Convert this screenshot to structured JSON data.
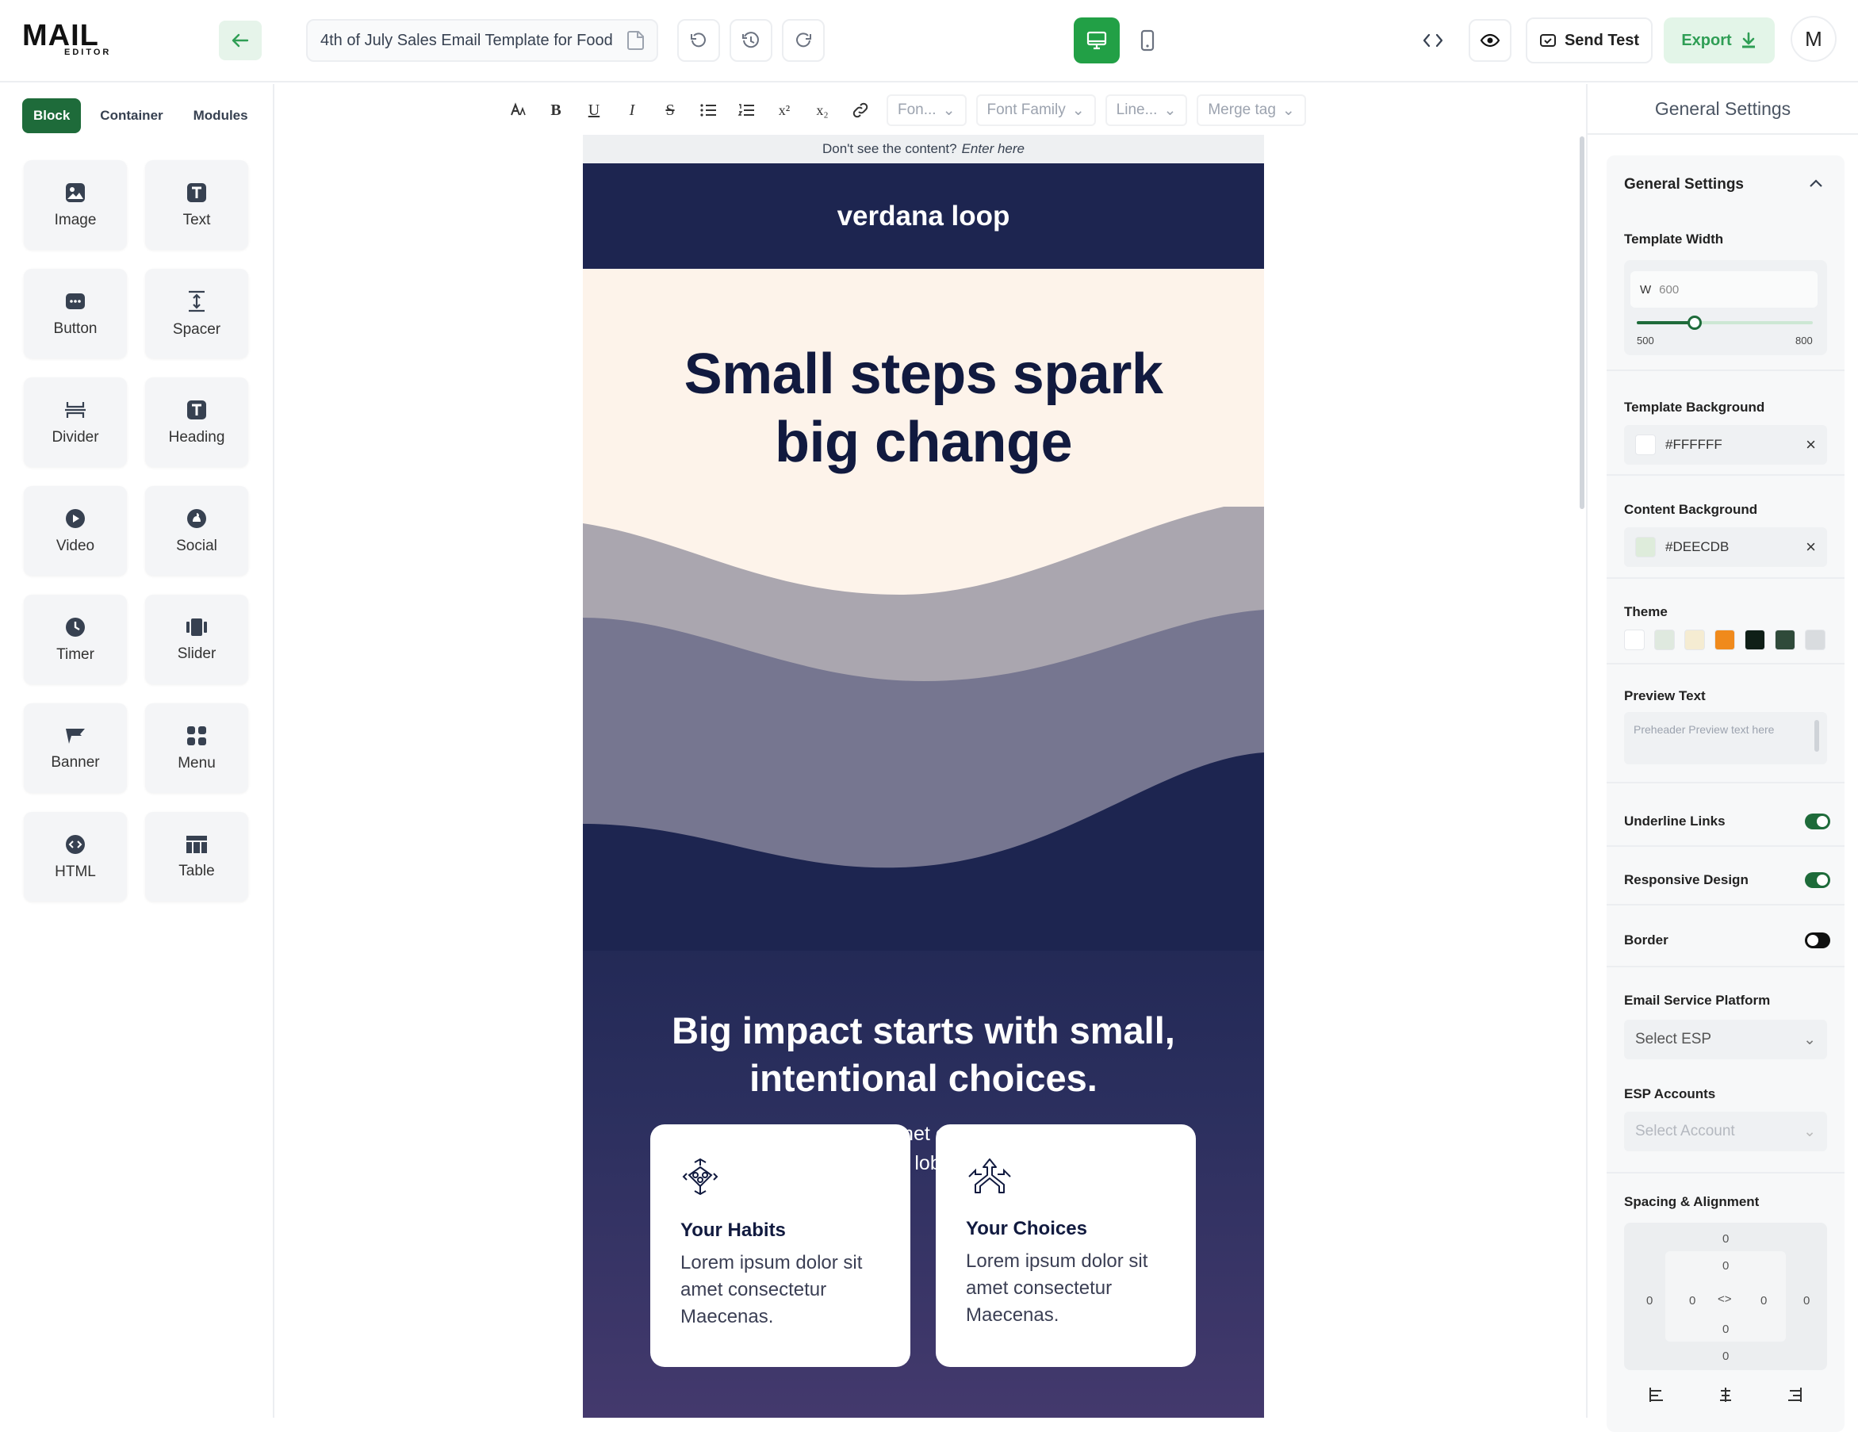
{
  "app": {
    "logo_main": "MAIL",
    "logo_sub": "EDITOR",
    "avatar": "M"
  },
  "topbar": {
    "doc_title": "4th of July Sales Email Template for Food",
    "send_test": "Send Test",
    "export": "Export"
  },
  "left": {
    "tabs": [
      "Block",
      "Container",
      "Modules"
    ],
    "blocks": [
      {
        "label": "Image",
        "icon": "image-icon"
      },
      {
        "label": "Text",
        "icon": "text-icon"
      },
      {
        "label": "Button",
        "icon": "button-icon"
      },
      {
        "label": "Spacer",
        "icon": "spacer-icon"
      },
      {
        "label": "Divider",
        "icon": "divider-icon"
      },
      {
        "label": "Heading",
        "icon": "heading-icon"
      },
      {
        "label": "Video",
        "icon": "video-icon"
      },
      {
        "label": "Social",
        "icon": "social-icon"
      },
      {
        "label": "Timer",
        "icon": "timer-icon"
      },
      {
        "label": "Slider",
        "icon": "slider-icon"
      },
      {
        "label": "Banner",
        "icon": "banner-icon"
      },
      {
        "label": "Menu",
        "icon": "menu-icon"
      },
      {
        "label": "HTML",
        "icon": "html-icon"
      },
      {
        "label": "Table",
        "icon": "table-icon"
      }
    ]
  },
  "toolbar": {
    "font_size": "Fon...",
    "font_family": "Font Family",
    "line_height": "Line...",
    "merge_tag": "Merge tag"
  },
  "email": {
    "notice": "Don't see the content?",
    "notice_link": "Enter here",
    "brand": "verdana loop",
    "hero_line1": "Small steps spark",
    "hero_line2": "big change",
    "sub_line1": "Big impact starts with small,",
    "sub_line2": "intentional choices.",
    "lead_line1": "Lorem ipsum dolor sit amet consectetur. Risus ipsum",
    "lead_line2": "mattis tristique lobortis convallis.",
    "cards": [
      {
        "title": "Your Habits",
        "line1": "Lorem ipsum dolor sit",
        "line2": "amet consectetur",
        "line3": "Maecenas."
      },
      {
        "title": "Your Choices",
        "line1": "Lorem ipsum dolor sit",
        "line2": "amet consectetur",
        "line3": "Maecenas."
      }
    ]
  },
  "settings": {
    "header": "General Settings",
    "section_title": "General Settings",
    "template_width": "Template Width",
    "width_prefix": "W",
    "width_value": "600",
    "width_min": "500",
    "width_max": "800",
    "width_fraction": 0.33,
    "template_bg_label": "Template Background",
    "template_bg": "#FFFFFF",
    "content_bg_label": "Content Background",
    "content_bg": "#DEECDB",
    "theme_label": "Theme",
    "theme_colors": [
      "#ffffff",
      "#dfe9df",
      "#f5ecd2",
      "#f08a1c",
      "#0f1f17",
      "#2f4a3a",
      "#d9dcdf"
    ],
    "preview_label": "Preview Text",
    "preview_placeholder": "Preheader Preview text here",
    "underline_links": "Underline Links",
    "underline_on": true,
    "responsive": "Responsive Design",
    "responsive_on": true,
    "border": "Border",
    "border_on": false,
    "esp_label": "Email Service Platform",
    "esp_placeholder": "Select ESP",
    "accounts_label": "ESP Accounts",
    "accounts_placeholder": "Select Account",
    "spacing_label": "Spacing & Alignment",
    "spacing": {
      "top": "0",
      "inner_top": "0",
      "left": "0",
      "inner_left": "0",
      "inner_right": "0",
      "right": "0",
      "inner_bottom": "0",
      "bottom": "0"
    }
  }
}
